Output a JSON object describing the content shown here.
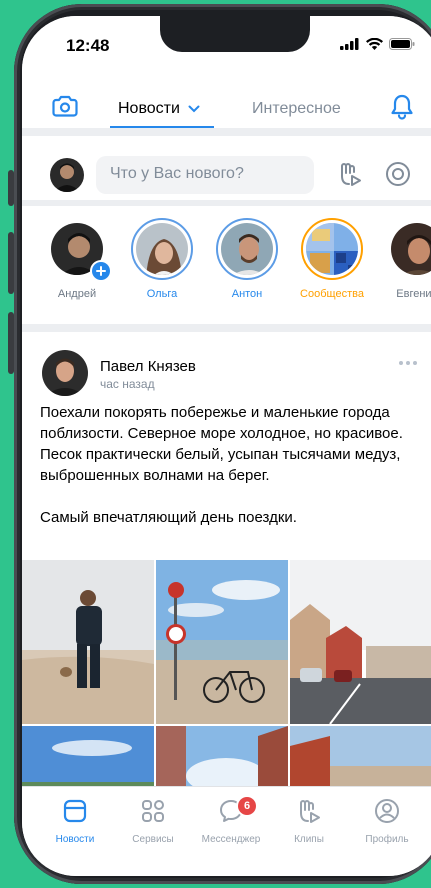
{
  "status_bar": {
    "time": "12:48"
  },
  "header": {
    "tabs": [
      {
        "label": "Новости",
        "active": true
      },
      {
        "label": "Интересное",
        "active": false
      }
    ]
  },
  "compose": {
    "placeholder": "Что у Вас нового?"
  },
  "stories": [
    {
      "name": "Андрей",
      "ring": "none"
    },
    {
      "name": "Ольга",
      "ring": "blue"
    },
    {
      "name": "Антон",
      "ring": "blue"
    },
    {
      "name": "Сообщества",
      "ring": "orange"
    },
    {
      "name": "Евгений",
      "ring": "none"
    }
  ],
  "post": {
    "author": "Павел Князев",
    "time": "час назад",
    "text_paragraph_1": "Поехали покорять побережье и маленькие города поблизости. Северное море холодное, но красивое. Песок практически белый, усыпан тысячами медуз, выброшенных волнами на берег.",
    "text_paragraph_2": "Самый впечатляющий день поездки."
  },
  "tabbar": {
    "items": [
      {
        "label": "Новости",
        "icon": "news-icon",
        "active": true
      },
      {
        "label": "Сервисы",
        "icon": "services-icon",
        "active": false
      },
      {
        "label": "Мессенджер",
        "icon": "messenger-icon",
        "active": false,
        "badge": "6"
      },
      {
        "label": "Клипы",
        "icon": "clips-icon",
        "active": false
      },
      {
        "label": "Профиль",
        "icon": "profile-icon",
        "active": false
      }
    ]
  },
  "colors": {
    "accent": "#2688eb",
    "background": "#2fc48d",
    "secondary_text": "#818c99",
    "badge": "#e64646",
    "community_ring": "#ffa000"
  }
}
